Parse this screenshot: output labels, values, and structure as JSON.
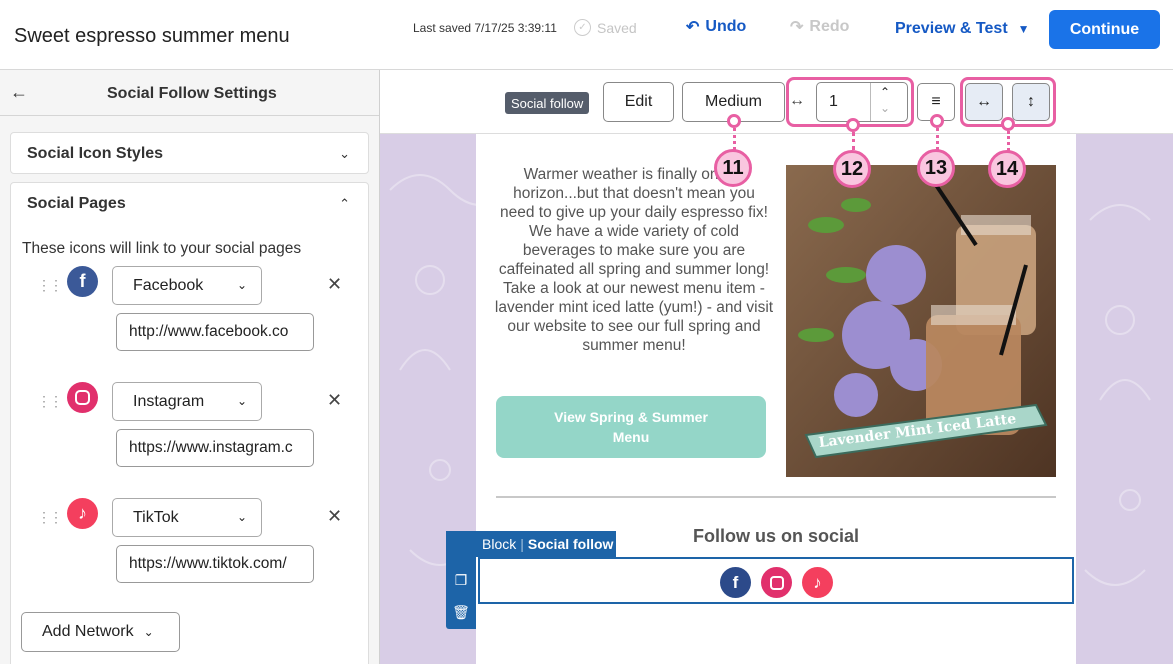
{
  "header": {
    "title": "Sweet espresso summer menu",
    "last_saved": "Last saved 7/17/25 3:39:11",
    "saved": "Saved",
    "undo": "Undo",
    "redo": "Redo",
    "preview": "Preview & Test",
    "continue": "Continue"
  },
  "panel": {
    "title": "Social Follow Settings",
    "sections": [
      {
        "label": "Social Icon Styles",
        "expanded": false
      },
      {
        "label": "Social Pages",
        "expanded": true
      }
    ],
    "intro": "These icons will link to your social pages",
    "networks": [
      {
        "name": "Facebook",
        "url": "http://www.facebook.co",
        "icon": "facebook-icon",
        "color": "#3b5998"
      },
      {
        "name": "Instagram",
        "url": "https://www.instagram.c",
        "icon": "instagram-icon",
        "color": "#e1306c"
      },
      {
        "name": "TikTok",
        "url": "https://www.tiktok.com/",
        "icon": "tiktok-icon",
        "color": "#f43f5e"
      }
    ],
    "add_network": "Add Network"
  },
  "toolbar": {
    "tag": "Social follow",
    "edit": "Edit",
    "size": "Medium",
    "spacing": "1",
    "callouts": [
      "11",
      "12",
      "13",
      "14"
    ]
  },
  "email": {
    "paragraph": "Warmer weather is finally on the horizon...but that doesn't mean you need to give up your daily espresso fix! We have a wide variety of cold beverages to make sure you are caffeinated all spring and summer long! Take a look at our newest menu item - lavender mint iced latte (yum!) - and visit our website to see our full spring and summer menu!",
    "cta": "View Spring & Summer Menu",
    "photo_banner": "Lavender Mint Iced Latte",
    "follow_heading": "Follow us on social",
    "block_label": "Block",
    "block_type": "Social follow"
  },
  "colors": {
    "accent": "#1a73e8",
    "callout": "#e85fa3",
    "canvas_bg": "#d8cde6",
    "cta": "#94d6c8",
    "block": "#1d64a8"
  }
}
